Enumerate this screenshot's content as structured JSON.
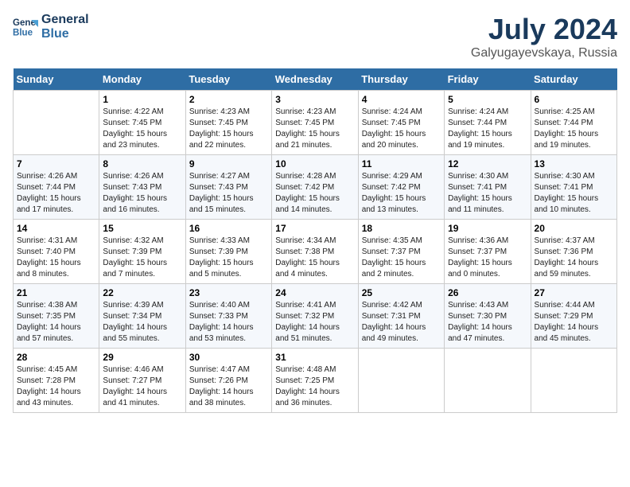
{
  "header": {
    "logo_line1": "General",
    "logo_line2": "Blue",
    "title": "July 2024",
    "subtitle": "Galyugayevskaya, Russia"
  },
  "days_of_week": [
    "Sunday",
    "Monday",
    "Tuesday",
    "Wednesday",
    "Thursday",
    "Friday",
    "Saturday"
  ],
  "weeks": [
    [
      {
        "day": "",
        "sunrise": "",
        "sunset": "",
        "daylight": ""
      },
      {
        "day": "1",
        "sunrise": "Sunrise: 4:22 AM",
        "sunset": "Sunset: 7:45 PM",
        "daylight": "Daylight: 15 hours and 23 minutes."
      },
      {
        "day": "2",
        "sunrise": "Sunrise: 4:23 AM",
        "sunset": "Sunset: 7:45 PM",
        "daylight": "Daylight: 15 hours and 22 minutes."
      },
      {
        "day": "3",
        "sunrise": "Sunrise: 4:23 AM",
        "sunset": "Sunset: 7:45 PM",
        "daylight": "Daylight: 15 hours and 21 minutes."
      },
      {
        "day": "4",
        "sunrise": "Sunrise: 4:24 AM",
        "sunset": "Sunset: 7:45 PM",
        "daylight": "Daylight: 15 hours and 20 minutes."
      },
      {
        "day": "5",
        "sunrise": "Sunrise: 4:24 AM",
        "sunset": "Sunset: 7:44 PM",
        "daylight": "Daylight: 15 hours and 19 minutes."
      },
      {
        "day": "6",
        "sunrise": "Sunrise: 4:25 AM",
        "sunset": "Sunset: 7:44 PM",
        "daylight": "Daylight: 15 hours and 19 minutes."
      }
    ],
    [
      {
        "day": "7",
        "sunrise": "Sunrise: 4:26 AM",
        "sunset": "Sunset: 7:44 PM",
        "daylight": "Daylight: 15 hours and 17 minutes."
      },
      {
        "day": "8",
        "sunrise": "Sunrise: 4:26 AM",
        "sunset": "Sunset: 7:43 PM",
        "daylight": "Daylight: 15 hours and 16 minutes."
      },
      {
        "day": "9",
        "sunrise": "Sunrise: 4:27 AM",
        "sunset": "Sunset: 7:43 PM",
        "daylight": "Daylight: 15 hours and 15 minutes."
      },
      {
        "day": "10",
        "sunrise": "Sunrise: 4:28 AM",
        "sunset": "Sunset: 7:42 PM",
        "daylight": "Daylight: 15 hours and 14 minutes."
      },
      {
        "day": "11",
        "sunrise": "Sunrise: 4:29 AM",
        "sunset": "Sunset: 7:42 PM",
        "daylight": "Daylight: 15 hours and 13 minutes."
      },
      {
        "day": "12",
        "sunrise": "Sunrise: 4:30 AM",
        "sunset": "Sunset: 7:41 PM",
        "daylight": "Daylight: 15 hours and 11 minutes."
      },
      {
        "day": "13",
        "sunrise": "Sunrise: 4:30 AM",
        "sunset": "Sunset: 7:41 PM",
        "daylight": "Daylight: 15 hours and 10 minutes."
      }
    ],
    [
      {
        "day": "14",
        "sunrise": "Sunrise: 4:31 AM",
        "sunset": "Sunset: 7:40 PM",
        "daylight": "Daylight: 15 hours and 8 minutes."
      },
      {
        "day": "15",
        "sunrise": "Sunrise: 4:32 AM",
        "sunset": "Sunset: 7:39 PM",
        "daylight": "Daylight: 15 hours and 7 minutes."
      },
      {
        "day": "16",
        "sunrise": "Sunrise: 4:33 AM",
        "sunset": "Sunset: 7:39 PM",
        "daylight": "Daylight: 15 hours and 5 minutes."
      },
      {
        "day": "17",
        "sunrise": "Sunrise: 4:34 AM",
        "sunset": "Sunset: 7:38 PM",
        "daylight": "Daylight: 15 hours and 4 minutes."
      },
      {
        "day": "18",
        "sunrise": "Sunrise: 4:35 AM",
        "sunset": "Sunset: 7:37 PM",
        "daylight": "Daylight: 15 hours and 2 minutes."
      },
      {
        "day": "19",
        "sunrise": "Sunrise: 4:36 AM",
        "sunset": "Sunset: 7:37 PM",
        "daylight": "Daylight: 15 hours and 0 minutes."
      },
      {
        "day": "20",
        "sunrise": "Sunrise: 4:37 AM",
        "sunset": "Sunset: 7:36 PM",
        "daylight": "Daylight: 14 hours and 59 minutes."
      }
    ],
    [
      {
        "day": "21",
        "sunrise": "Sunrise: 4:38 AM",
        "sunset": "Sunset: 7:35 PM",
        "daylight": "Daylight: 14 hours and 57 minutes."
      },
      {
        "day": "22",
        "sunrise": "Sunrise: 4:39 AM",
        "sunset": "Sunset: 7:34 PM",
        "daylight": "Daylight: 14 hours and 55 minutes."
      },
      {
        "day": "23",
        "sunrise": "Sunrise: 4:40 AM",
        "sunset": "Sunset: 7:33 PM",
        "daylight": "Daylight: 14 hours and 53 minutes."
      },
      {
        "day": "24",
        "sunrise": "Sunrise: 4:41 AM",
        "sunset": "Sunset: 7:32 PM",
        "daylight": "Daylight: 14 hours and 51 minutes."
      },
      {
        "day": "25",
        "sunrise": "Sunrise: 4:42 AM",
        "sunset": "Sunset: 7:31 PM",
        "daylight": "Daylight: 14 hours and 49 minutes."
      },
      {
        "day": "26",
        "sunrise": "Sunrise: 4:43 AM",
        "sunset": "Sunset: 7:30 PM",
        "daylight": "Daylight: 14 hours and 47 minutes."
      },
      {
        "day": "27",
        "sunrise": "Sunrise: 4:44 AM",
        "sunset": "Sunset: 7:29 PM",
        "daylight": "Daylight: 14 hours and 45 minutes."
      }
    ],
    [
      {
        "day": "28",
        "sunrise": "Sunrise: 4:45 AM",
        "sunset": "Sunset: 7:28 PM",
        "daylight": "Daylight: 14 hours and 43 minutes."
      },
      {
        "day": "29",
        "sunrise": "Sunrise: 4:46 AM",
        "sunset": "Sunset: 7:27 PM",
        "daylight": "Daylight: 14 hours and 41 minutes."
      },
      {
        "day": "30",
        "sunrise": "Sunrise: 4:47 AM",
        "sunset": "Sunset: 7:26 PM",
        "daylight": "Daylight: 14 hours and 38 minutes."
      },
      {
        "day": "31",
        "sunrise": "Sunrise: 4:48 AM",
        "sunset": "Sunset: 7:25 PM",
        "daylight": "Daylight: 14 hours and 36 minutes."
      },
      {
        "day": "",
        "sunrise": "",
        "sunset": "",
        "daylight": ""
      },
      {
        "day": "",
        "sunrise": "",
        "sunset": "",
        "daylight": ""
      },
      {
        "day": "",
        "sunrise": "",
        "sunset": "",
        "daylight": ""
      }
    ]
  ]
}
